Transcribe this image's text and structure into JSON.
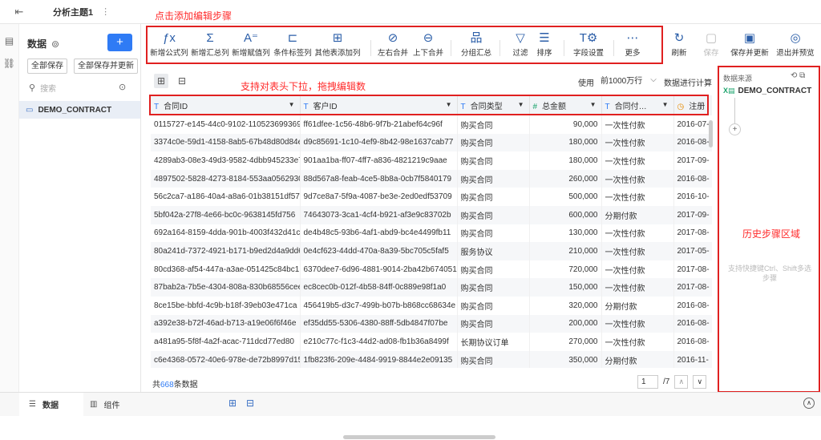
{
  "header": {
    "back_icon": "exit-icon",
    "tab_title": "分析主题1",
    "more": "⋮"
  },
  "annotations": {
    "top": "点击添加编辑步骤",
    "grid": "支持对表头下拉，拖拽编辑数",
    "history": "历史步骤区域"
  },
  "left": {
    "title": "数据",
    "add": "+",
    "save_all": "全部保存",
    "save_update_all": "全部保存并更新",
    "search_placeholder": "搜索",
    "table_name": "DEMO_CONTRACT"
  },
  "toolbar": {
    "items": [
      {
        "label": "新增公式列",
        "icon": "fx-icon"
      },
      {
        "label": "新增汇总列",
        "icon": "sigma-icon"
      },
      {
        "label": "新增赋值列",
        "icon": "assign-icon"
      },
      {
        "label": "条件标签列",
        "icon": "condition-icon"
      },
      {
        "label": "其他表添加列",
        "icon": "add-column-icon"
      },
      {
        "label": "左右合并",
        "icon": "merge-lr-icon"
      },
      {
        "label": "上下合并",
        "icon": "merge-ud-icon"
      },
      {
        "label": "分组汇总",
        "icon": "group-icon"
      },
      {
        "label": "过滤",
        "icon": "filter-icon"
      },
      {
        "label": "排序",
        "icon": "sort-icon"
      },
      {
        "label": "字段设置",
        "icon": "field-settings-icon"
      },
      {
        "label": "更多",
        "icon": "more-icon"
      }
    ],
    "refresh": "刷新",
    "save": "保存",
    "save_update": "保存并更新",
    "exit_preview": "退出并预览"
  },
  "grid_controls": {
    "use": "使用",
    "row_select": "前1000万行",
    "calc": "数据进行计算"
  },
  "table": {
    "columns": [
      {
        "name": "合同ID",
        "type": "T"
      },
      {
        "name": "客户ID",
        "type": "T"
      },
      {
        "name": "合同类型",
        "type": "T"
      },
      {
        "name": "总金额",
        "type": "#"
      },
      {
        "name": "合同付…",
        "type": "T"
      },
      {
        "name": "注册",
        "type": "date"
      }
    ],
    "rows": [
      [
        "0115727-e145-44c0-9102-110523699369",
        "ff61dfee-1c56-48b6-9f7b-21abef64c96f",
        "购买合同",
        "90,000",
        "一次性付款",
        "2016-07-"
      ],
      [
        "3374c0e-59d1-4158-8ab5-67b48d80d84e",
        "d9c85691-1c10-4ef9-8b42-98e1637cab77",
        "购买合同",
        "180,000",
        "一次性付款",
        "2016-08-"
      ],
      [
        "4289ab3-08e3-49d3-9582-4dbb945233e7",
        "901aa1ba-ff07-4ff7-a836-4821219c9aae",
        "购买合同",
        "180,000",
        "一次性付款",
        "2017-09-"
      ],
      [
        "4897502-5828-4273-8184-553aa0562930",
        "88d567a8-feab-4ce5-8b8a-0cb7f5840179",
        "购买合同",
        "260,000",
        "一次性付款",
        "2016-08-"
      ],
      [
        "56c2ca7-a186-40a4-a8a6-01b38151df57",
        "9d7ce8a7-5f9a-4087-be3e-2ed0edf53709",
        "购买合同",
        "500,000",
        "一次性付款",
        "2016-10-"
      ],
      [
        "5bf042a-27f8-4e66-bc0c-9638145fd756",
        "74643073-3ca1-4cf4-b921-af3e9c83702b",
        "购买合同",
        "600,000",
        "分期付款",
        "2017-09-"
      ],
      [
        "692a164-8159-4dda-901b-4003f432d41c",
        "de4b48c5-93b6-4af1-abd9-bc4e4499fb11",
        "购买合同",
        "130,000",
        "一次性付款",
        "2017-08-"
      ],
      [
        "80a241d-7372-4921-b171-b9ed2d4a9dd6",
        "0e4cf623-44dd-470a-8a39-5bc705c5faf5",
        "服务协议",
        "210,000",
        "一次性付款",
        "2017-05-"
      ],
      [
        "80cd368-af54-447a-a3ae-051425c84bc1",
        "6370dee7-6d96-4881-9014-2ba42b674051",
        "购买合同",
        "720,000",
        "一次性付款",
        "2017-08-"
      ],
      [
        "87bab2a-7b5e-4304-808a-830b68556cee",
        "ec8cec0b-012f-4b58-84ff-0c889e98f1a0",
        "购买合同",
        "150,000",
        "一次性付款",
        "2017-08-"
      ],
      [
        "8ce15be-bbfd-4c9b-b18f-39eb03e471ca",
        "456419b5-d3c7-499b-b07b-b868cc68634e",
        "购买合同",
        "320,000",
        "分期付款",
        "2016-08-"
      ],
      [
        "a392e38-b72f-46ad-b713-a19e06f6f46e",
        "ef35dd55-5306-4380-88ff-5db4847f07be",
        "购买合同",
        "200,000",
        "一次性付款",
        "2016-08-"
      ],
      [
        "a481a95-5f8f-4a2f-acac-711dcd77ed80",
        "e210c77c-f1c3-44d2-ad08-fb1b36a8499f",
        "长期协议订单",
        "270,000",
        "一次性付款",
        "2016-08-"
      ],
      [
        "c6e4368-0572-40e6-978e-de72b8997d15",
        "1fb823f6-209e-4484-9919-8844e2e09135",
        "购买合同",
        "350,000",
        "分期付款",
        "2016-11-"
      ]
    ]
  },
  "footer": {
    "prefix": "共",
    "count": "668",
    "suffix": "条数据",
    "page": "1",
    "total": "/7"
  },
  "right_panel": {
    "source_label": "数据来源",
    "dataset": "DEMO_CONTRACT",
    "add": "+",
    "tip": "支持快捷键Ctrl、Shift多选步骤"
  },
  "bottom": {
    "data_tab": "数据",
    "component_tab": "组件"
  },
  "colors": {
    "accent": "#2f7bf5",
    "annotation": "#ff2a2a",
    "highlight_box": "#e02020"
  }
}
